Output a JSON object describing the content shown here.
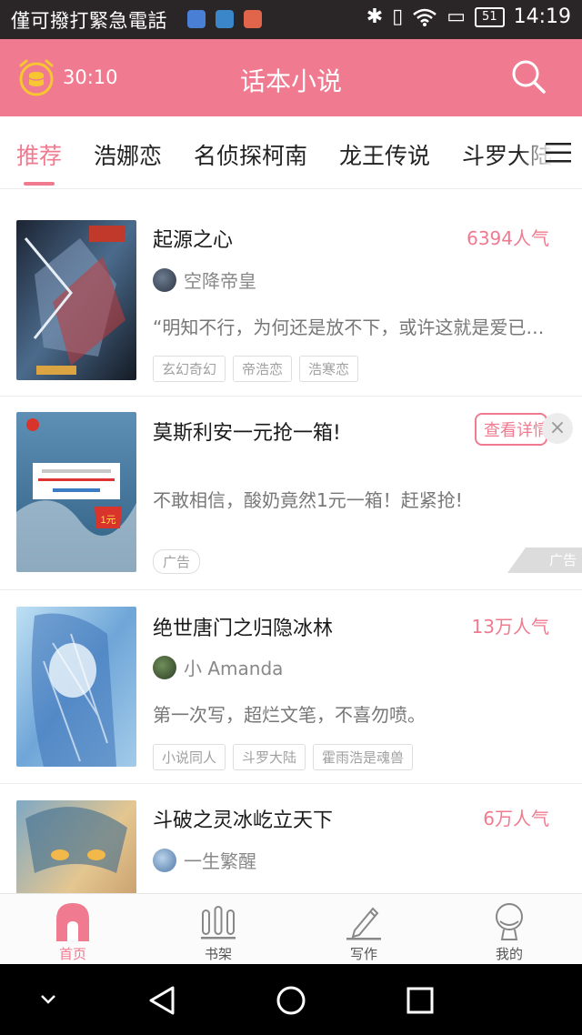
{
  "status_bar": {
    "carrier": "僅可撥打緊急電話",
    "battery": "51",
    "time": "14:19"
  },
  "header": {
    "timer": "30:10",
    "title": "话本小说",
    "icons": [
      "alarm-coin-icon",
      "search-icon"
    ]
  },
  "tabs": {
    "items": [
      "推荐",
      "浩娜恋",
      "名侦探柯南",
      "龙王传说",
      "斗罗大陆"
    ],
    "active_index": 0
  },
  "books": [
    {
      "title": "起源之心",
      "popularity": "6394人气",
      "author": "空降帝皇",
      "description": "“明知不行，为何还是放不下，或许这就是爱已…",
      "tags": [
        "玄幻奇幻",
        "帝浩恋",
        "浩寒恋"
      ]
    },
    {
      "title": "绝世唐门之归隐冰林",
      "popularity": "13万人气",
      "author": "小 Amanda",
      "description": "第一次写，超烂文笔，不喜勿喷。",
      "tags": [
        "小说同人",
        "斗罗大陆",
        "霍雨浩是魂兽"
      ]
    },
    {
      "title": "斗破之灵冰屹立天下",
      "popularity": "6万人气",
      "author": "一生繁醒",
      "description": "",
      "tags": []
    }
  ],
  "ad": {
    "title": "莫斯利安一元抢一箱!",
    "button": "查看详情",
    "close": "×",
    "description": "不敢相信，酸奶竟然1元一箱！赶紧抢!",
    "badge": "广告",
    "mark": "广告",
    "cover_price": "1元"
  },
  "bottom_nav": {
    "items": [
      {
        "label": "首页",
        "icon": "home-icon"
      },
      {
        "label": "书架",
        "icon": "bookshelf-icon"
      },
      {
        "label": "写作",
        "icon": "pencil-icon"
      },
      {
        "label": "我的",
        "icon": "profile-icon"
      }
    ],
    "active_index": 0
  },
  "colors": {
    "accent": "#f07a8f",
    "status_bar": "#2a2526"
  }
}
